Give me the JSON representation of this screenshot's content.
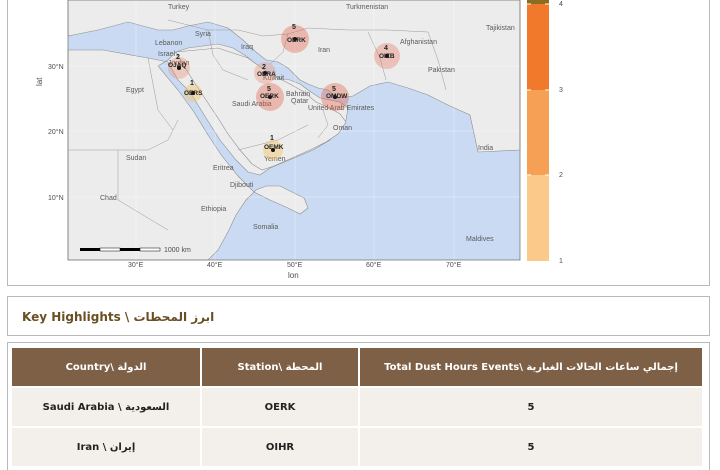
{
  "map": {
    "y_axis_title": "lat",
    "x_axis_title": "lon",
    "lat_ticks": [
      "30°N",
      "20°N",
      "10°N"
    ],
    "lon_ticks": [
      "30°E",
      "40°E",
      "50°E",
      "60°E",
      "70°E"
    ],
    "scale_bar": "1000 km",
    "places": [
      {
        "name": "Turkey"
      },
      {
        "name": "Turkmenistan"
      },
      {
        "name": "Syria"
      },
      {
        "name": "Lebanon"
      },
      {
        "name": "Israel"
      },
      {
        "name": "Iraq"
      },
      {
        "name": "Iran"
      },
      {
        "name": "Afghanistan"
      },
      {
        "name": "Pakistan"
      },
      {
        "name": "Egypt"
      },
      {
        "name": "Saudi Arabia"
      },
      {
        "name": "Bahrain"
      },
      {
        "name": "Qatar"
      },
      {
        "name": "United Arab Emirates"
      },
      {
        "name": "Oman"
      },
      {
        "name": "Yemen"
      },
      {
        "name": "Sudan"
      },
      {
        "name": "Eritrea"
      },
      {
        "name": "Djibouti"
      },
      {
        "name": "Ethiopia"
      },
      {
        "name": "Somalia"
      },
      {
        "name": "Maldives"
      },
      {
        "name": "Tajikistan"
      },
      {
        "name": "Jordan"
      },
      {
        "name": "Kuwait"
      },
      {
        "name": "Chad"
      },
      {
        "name": "India"
      }
    ],
    "stations": [
      {
        "code": "OERK",
        "count": "5",
        "color": "#e2563a"
      },
      {
        "code": "OJAQ",
        "count": "2",
        "color": "#ee8a6b"
      },
      {
        "code": "OERS",
        "count": "1",
        "color": "#f4c36a"
      },
      {
        "code": "OERA",
        "count": "2",
        "color": "#ee8a6b"
      },
      {
        "code": "OERK",
        "count": "5",
        "color": "#e2563a"
      },
      {
        "code": "OIZB",
        "count": "4",
        "color": "#e9705a"
      },
      {
        "code": "OMDW",
        "count": "5",
        "color": "#e2563a"
      },
      {
        "code": "OEMK",
        "count": "1",
        "color": "#f4c36a"
      }
    ],
    "legend": {
      "ticks": [
        "4",
        "3",
        "2",
        "1"
      ],
      "colors": [
        "#f0792b",
        "#f5a055",
        "#f9c080",
        "#fde2bf"
      ]
    },
    "colors": {
      "land": "#ececec",
      "water": "#c9daf2",
      "border": "#8e8e8e"
    }
  },
  "highlights": {
    "title": "Key Highlights \\ ابرز المحطات"
  },
  "table": {
    "headers": [
      "Country\\ الدولة",
      "Station\\ المحطة",
      "Total Dust Hours Events\\  إجمالي ساعات الحالات الغبارية"
    ],
    "rows": [
      {
        "country": "Saudi Arabia \\ السعودية",
        "station": "OERK",
        "total": "5"
      },
      {
        "country": "Iran \\ إيران",
        "station": "OIHR",
        "total": "5"
      }
    ],
    "header_color": "#7d6046",
    "row_color": "#f3f0ec"
  }
}
